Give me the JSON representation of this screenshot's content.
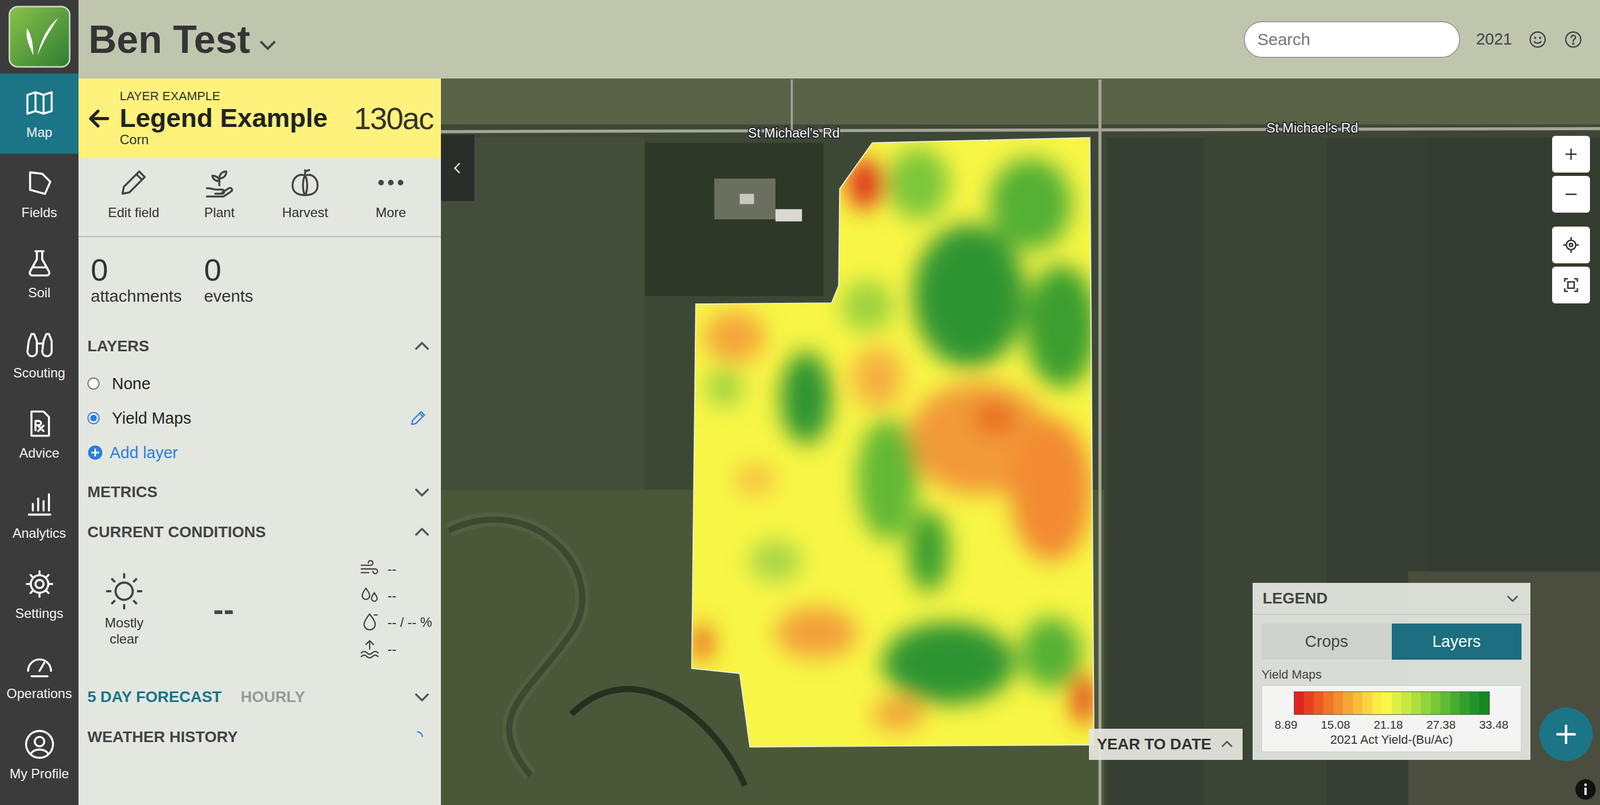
{
  "app": {
    "title": "Ben Test"
  },
  "search": {
    "placeholder": "Search"
  },
  "year": "2021",
  "nav": [
    {
      "label": "Map",
      "selected": true
    },
    {
      "label": "Fields",
      "selected": false
    },
    {
      "label": "Soil",
      "selected": false
    },
    {
      "label": "Scouting",
      "selected": false
    },
    {
      "label": "Advice",
      "selected": false
    },
    {
      "label": "Analytics",
      "selected": false
    },
    {
      "label": "Settings",
      "selected": false
    },
    {
      "label": "Operations",
      "selected": false
    },
    {
      "label": "My Profile",
      "selected": false
    }
  ],
  "field": {
    "eyebrow": "LAYER EXAMPLE",
    "name": "Legend Example",
    "crop": "Corn",
    "area": "130ac"
  },
  "actions": [
    "Edit field",
    "Plant",
    "Harvest",
    "More"
  ],
  "counts": [
    {
      "value": "0",
      "label": "attachments"
    },
    {
      "value": "0",
      "label": "events"
    }
  ],
  "layers": {
    "title": "LAYERS",
    "expanded": true,
    "options": [
      {
        "label": "None",
        "selected": false
      },
      {
        "label": "Yield Maps",
        "selected": true
      }
    ],
    "add": "Add layer"
  },
  "metrics": {
    "title": "METRICS",
    "expanded": false
  },
  "conditions": {
    "title": "CURRENT CONDITIONS",
    "expanded": true,
    "sky": "Mostly clear",
    "temperature": "--",
    "readings": [
      "--",
      "--",
      "-- / -- %",
      "--"
    ]
  },
  "forecast": {
    "tabs": [
      {
        "label": "5 DAY FORECAST",
        "selected": true
      },
      {
        "label": "HOURLY",
        "selected": false
      }
    ],
    "expanded": false
  },
  "weather_history": {
    "title": "WEATHER HISTORY",
    "loading": true
  },
  "map": {
    "roads": [
      "St Michael's Rd",
      "St Michael's Rd"
    ],
    "period": {
      "label": "YEAR TO DATE",
      "expanded": false
    }
  },
  "legend": {
    "title": "LEGEND",
    "expanded": true,
    "tabs": [
      {
        "label": "Crops",
        "selected": false
      },
      {
        "label": "Layers",
        "selected": true
      }
    ],
    "layer": "Yield Maps",
    "swatches": [
      "#e0261c",
      "#e6401f",
      "#ec5a24",
      "#f07529",
      "#f38d2f",
      "#f5a535",
      "#f7bd3b",
      "#f9d540",
      "#fbec45",
      "#f6f746",
      "#dff045",
      "#c6e843",
      "#acdf40",
      "#92d43c",
      "#78c837",
      "#5fbb33",
      "#48ad2f",
      "#33a02b",
      "#229327",
      "#158823"
    ],
    "ticks": [
      "8.89",
      "15.08",
      "21.18",
      "27.38",
      "33.48"
    ],
    "caption": "2021 Act Yield-(Bu/Ac)"
  }
}
